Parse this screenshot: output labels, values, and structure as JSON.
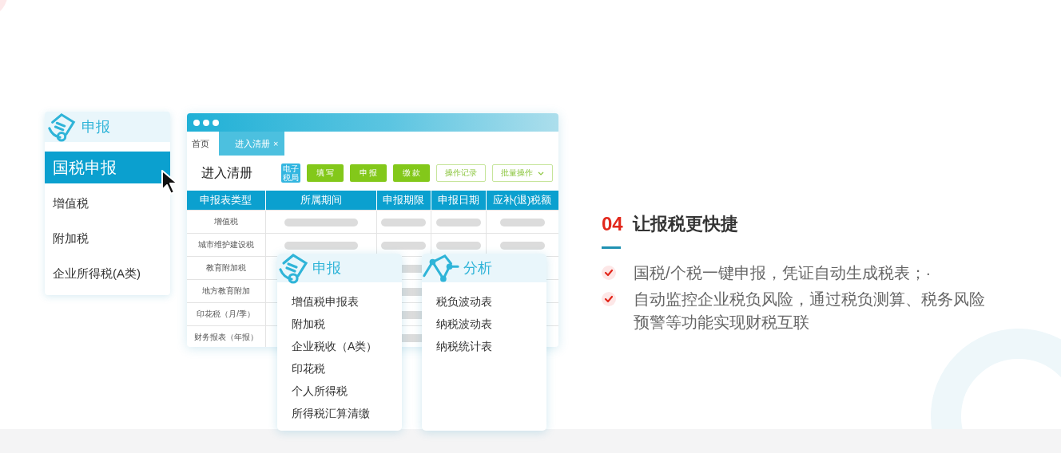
{
  "left_menu": {
    "title": "申报",
    "items": [
      {
        "label": "国税申报",
        "selected": true
      },
      {
        "label": "增值税",
        "selected": false
      },
      {
        "label": "附加税",
        "selected": false
      },
      {
        "label": "企业所得税(A类)",
        "selected": false
      }
    ]
  },
  "window": {
    "tabs": [
      {
        "label": "首页",
        "selected": false
      },
      {
        "label": "进入清册",
        "selected": true,
        "close_glyph": "×"
      }
    ],
    "page_title": "进入清册",
    "badge": "电子税局",
    "buttons": [
      {
        "label": "填 写",
        "kind": "filled"
      },
      {
        "label": "申 报",
        "kind": "filled"
      },
      {
        "label": "缴 款",
        "kind": "filled"
      },
      {
        "label": "操作记录",
        "kind": "outline"
      },
      {
        "label": "批量操作",
        "kind": "dropdown"
      }
    ],
    "table": {
      "columns": [
        "申报表类型",
        "所属期间",
        "申报期限",
        "申报日期",
        "应补(退)税额"
      ],
      "rows": [
        "增值税",
        "城市维护建设税",
        "教育附加税",
        "地方教育附加",
        "印花税（月/季）",
        "财务报表（年报）"
      ]
    }
  },
  "cards": [
    {
      "kind": "report",
      "title": "申报",
      "items": [
        "增值税申报表",
        "附加税",
        "企业税收（A类）",
        "印花税",
        "个人所得税",
        "所得税汇算清缴"
      ]
    },
    {
      "kind": "analysis",
      "title": "分析",
      "items": [
        "税负波动表",
        "纳税波动表",
        "纳税统计表"
      ]
    }
  ],
  "feature": {
    "number": "04",
    "title": "让报税更快捷",
    "bullets": [
      "国税/个税一键申报，凭证自动生成税表；·",
      "自动监控企业税负风险，通过税负测算、税务风险预警等功能实现财税互联"
    ]
  }
}
